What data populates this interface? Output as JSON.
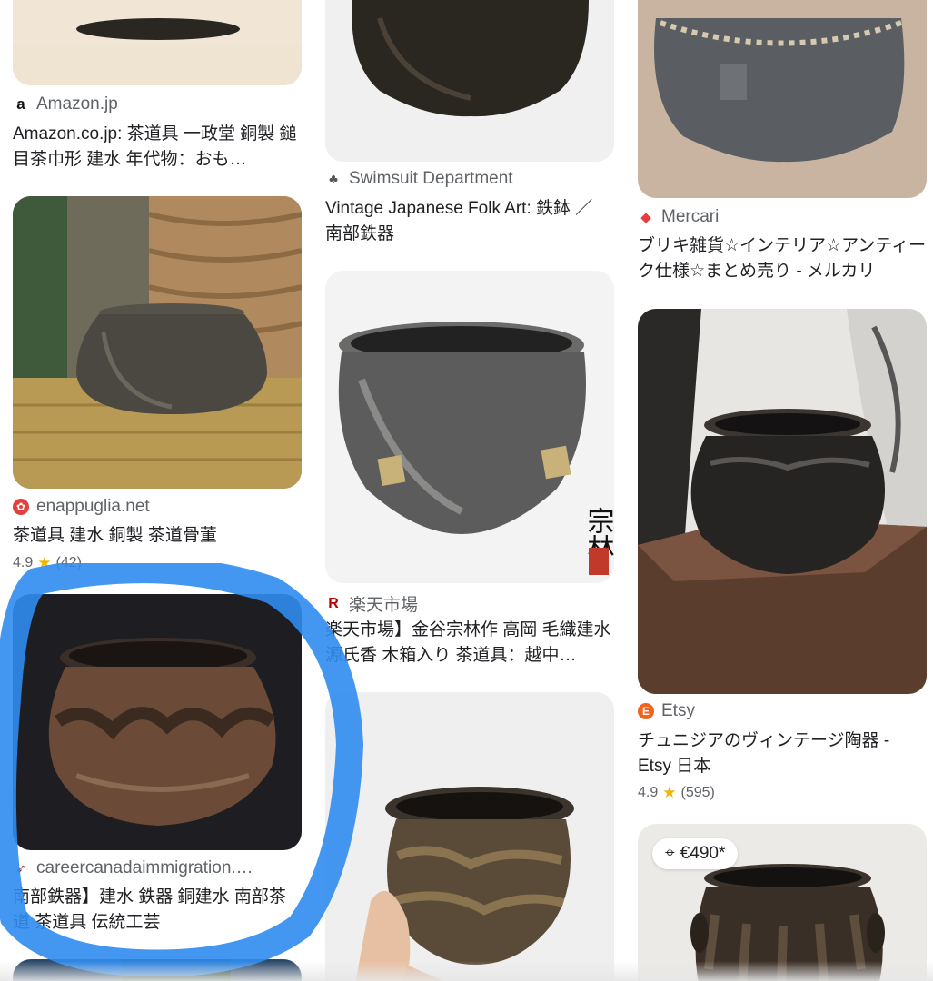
{
  "columns": [
    {
      "cards": [
        {
          "source": "Amazon.jp",
          "favicon": "amazon-a-icon",
          "title": "Amazon.co.jp: 茶道具 一政堂 銅製 鎚目茶巾形 建水 年代物：おも…"
        },
        {
          "source": "enappuglia.net",
          "favicon": "enappuglia-icon",
          "title": "茶道具 建水 銅製 茶道骨董",
          "rating": "4.9",
          "rating_count": "(42)"
        },
        {
          "source": "careercanadaimmigration.…",
          "favicon": "bird-icon",
          "title": "南部鉄器】建水 鉄器 銅建水 南部茶道 茶道具 伝統工芸"
        }
      ]
    },
    {
      "cards": [
        {
          "source": "Swimsuit Department",
          "favicon": "swimsuit-icon",
          "title": "Vintage Japanese Folk Art: 鉄鉢 ／ 南部鉄器"
        },
        {
          "source": "楽天市場",
          "favicon": "rakuten-r-icon",
          "title": "楽天市場】金谷宗林作 高岡 毛織建水源氏香 木箱入り 茶道具：越中…"
        }
      ]
    },
    {
      "cards": [
        {
          "source": "Mercari",
          "favicon": "mercari-icon",
          "title": "ブリキ雑貨☆インテリア☆アンティーク仕様☆まとめ売り - メルカリ"
        },
        {
          "source": "Etsy",
          "favicon": "etsy-e-icon",
          "title": "チュニジアのヴィンテージ陶器 - Etsy 日本",
          "rating": "4.9",
          "rating_count": "(595)"
        },
        {
          "price": "€490*"
        }
      ]
    }
  ],
  "favicon_letters": {
    "amazon": "a",
    "rakuten": "R",
    "etsy": "E"
  },
  "colors": {
    "highlight": "#2f8cf0",
    "star": "#f4b400",
    "rakuten": "#bf0000",
    "etsy": "#f1641e",
    "enappuglia": "#e0413a",
    "mercari": "#e93b3b"
  }
}
